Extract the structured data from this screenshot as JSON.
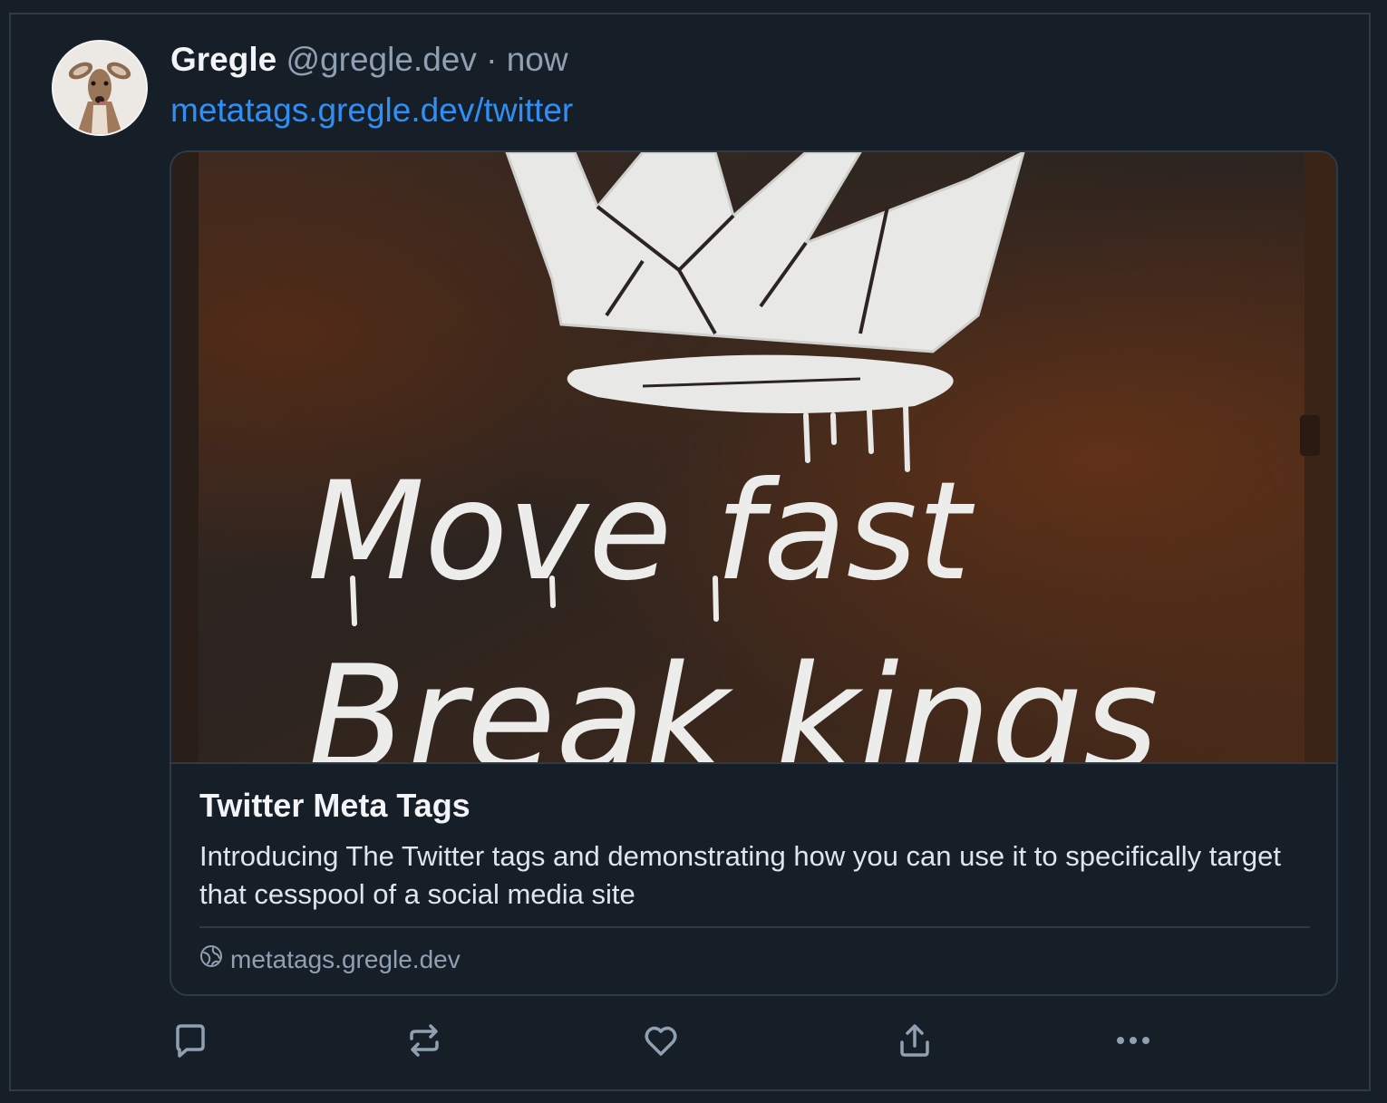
{
  "post": {
    "author_name": "Gregle",
    "author_handle": "@gregle.dev · now",
    "link_text": "metatags.gregle.dev/twitter"
  },
  "card": {
    "image_text": [
      "Move fast",
      "Break kings"
    ],
    "title": "Twitter Meta Tags",
    "description": "Introducing The Twitter tags and demonstrating how you can use it to specifically target that cesspool of a social media site",
    "domain": "metatags.gregle.dev",
    "domain_icon": "globe-icon"
  },
  "actions": [
    {
      "name": "reply",
      "icon": "comment-icon"
    },
    {
      "name": "repost",
      "icon": "repost-icon"
    },
    {
      "name": "like",
      "icon": "heart-icon"
    },
    {
      "name": "share",
      "icon": "share-icon"
    },
    {
      "name": "more",
      "icon": "more-icon"
    }
  ],
  "colors": {
    "background": "#161e27",
    "border": "#2c3a4a",
    "link": "#2f8ff5",
    "muted": "#8fa0b2",
    "text": "#f2f4f7"
  }
}
